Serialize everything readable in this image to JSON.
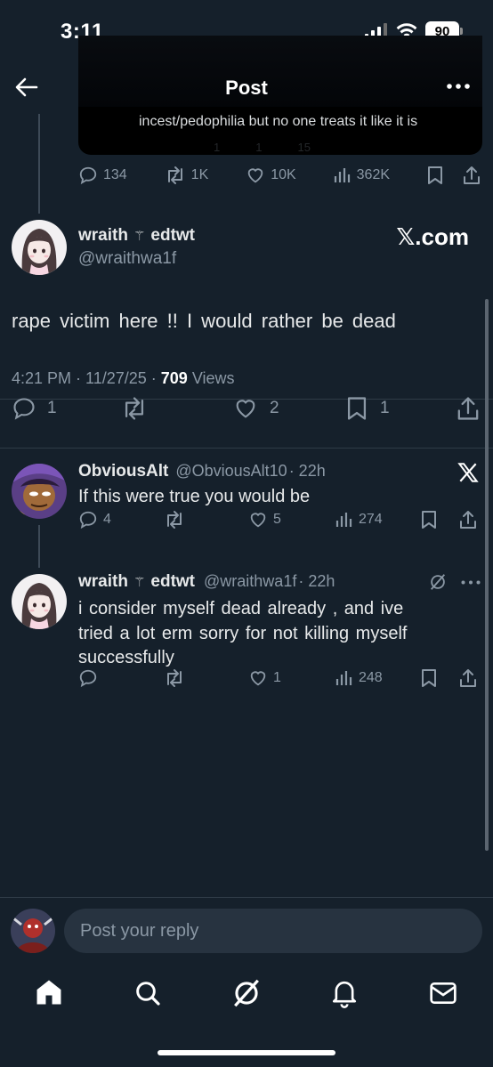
{
  "status": {
    "time": "3:11",
    "battery": "90"
  },
  "header": {
    "title": "Post"
  },
  "quoted": {
    "text": "incest/pedophilia but no one treats it like it is",
    "dim_counts": [
      "1",
      "1",
      "15"
    ]
  },
  "parent_actions": {
    "replies": "134",
    "reposts": "1K",
    "likes": "10K",
    "views": "362K"
  },
  "main_post": {
    "name": "wraith",
    "name_suffix": "edtwt",
    "handle": "@wraithwa1f",
    "badge": "𝕏.com",
    "text": "rape victim here !! I would rather be dead",
    "timestamp": "4:21 PM · 11/27/25 · ",
    "views_count": "709",
    "views_label": " Views",
    "replies": "1",
    "likes": "2",
    "bookmarks": "1"
  },
  "reply1": {
    "name": "ObviousAlt",
    "handle": "@ObviousAlt10",
    "time": "· 22h",
    "text": "If this were true you would be",
    "replies": "4",
    "likes": "5",
    "views": "274"
  },
  "reply2": {
    "name": "wraith",
    "name_suffix": "edtwt",
    "handle": "@wraithwa1f",
    "time": "· 22h",
    "text_line1": "i consider myself dead already , and ive",
    "text_line2": "tried a lot erm sorry for not killing myself",
    "text_line3": "successfully",
    "likes": "1",
    "views": "248"
  },
  "reply_box": {
    "placeholder": "Post your reply"
  },
  "colors": {
    "background": "#15202b",
    "muted": "#8b98a5",
    "text": "#e7e9ea",
    "input": "#273340"
  }
}
